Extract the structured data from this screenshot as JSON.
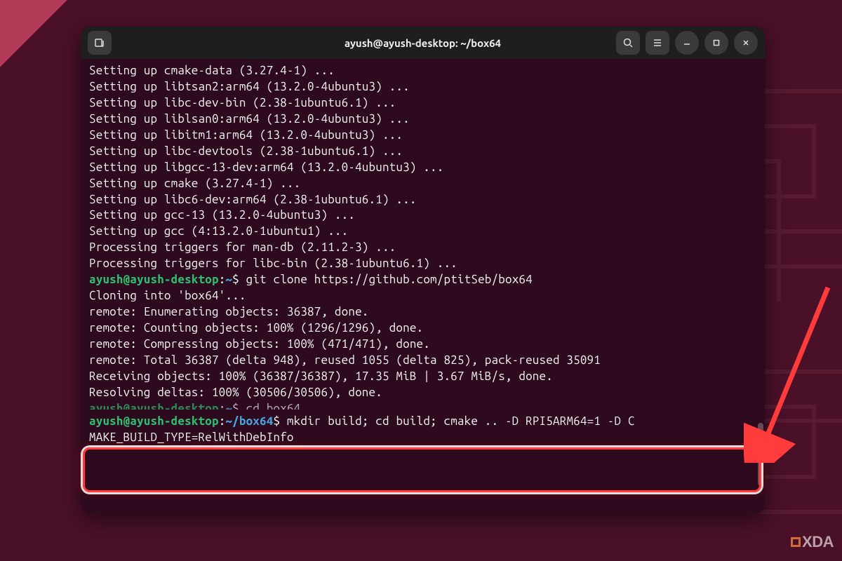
{
  "window": {
    "title": "ayush@ayush-desktop: ~/box64"
  },
  "prompt1": {
    "userhost": "ayush@ayush-desktop",
    "path": "~",
    "cmd": "git clone https://github.com/ptitSeb/box64"
  },
  "prompt2": {
    "userhost": "ayush@ayush-desktop",
    "path": "~/box64",
    "cmd_line1": "mkdir build; cd build; cmake .. -D RPI5ARM64=1 -D C",
    "cmd_line2": "MAKE_BUILD_TYPE=RelWithDebInfo"
  },
  "prompt_cut": {
    "userhost": "ayush@ayush-desktop",
    "path": "~",
    "cmd": "cd box64"
  },
  "lines": [
    "Setting up cmake-data (3.27.4-1) ...",
    "Setting up libtsan2:arm64 (13.2.0-4ubuntu3) ...",
    "Setting up libc-dev-bin (2.38-1ubuntu6.1) ...",
    "Setting up liblsan0:arm64 (13.2.0-4ubuntu3) ...",
    "Setting up libitm1:arm64 (13.2.0-4ubuntu3) ...",
    "Setting up libc-devtools (2.38-1ubuntu6.1) ...",
    "Setting up libgcc-13-dev:arm64 (13.2.0-4ubuntu3) ...",
    "Setting up cmake (3.27.4-1) ...",
    "Setting up libc6-dev:arm64 (2.38-1ubuntu6.1) ...",
    "Setting up gcc-13 (13.2.0-4ubuntu3) ...",
    "Setting up gcc (4:13.2.0-1ubuntu1) ...",
    "Processing triggers for man-db (2.11.2-3) ...",
    "Processing triggers for libc-bin (2.38-1ubuntu6.1) ..."
  ],
  "clone_lines": [
    "Cloning into 'box64'...",
    "remote: Enumerating objects: 36387, done.",
    "remote: Counting objects: 100% (1296/1296), done.",
    "remote: Compressing objects: 100% (471/471), done.",
    "remote: Total 36387 (delta 948), reused 1055 (delta 825), pack-reused 35091",
    "Receiving objects: 100% (36387/36387), 17.35 MiB | 3.67 MiB/s, done.",
    "Resolving deltas: 100% (30506/30506), done."
  ],
  "watermark": "XDA"
}
